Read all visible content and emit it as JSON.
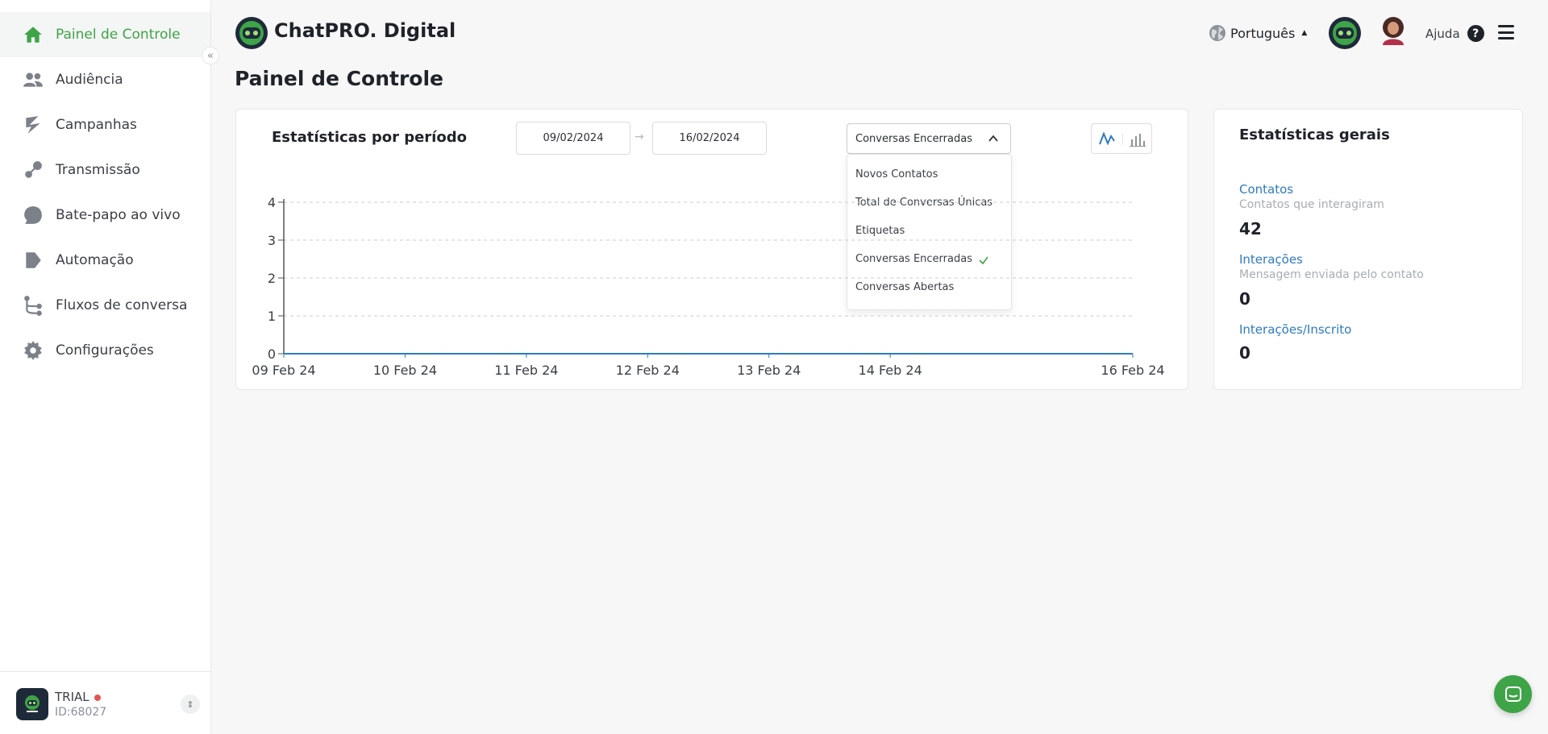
{
  "brand": {
    "name": "ChatPRO. Digital"
  },
  "sidebar": {
    "items": [
      {
        "label": "Painel de Controle",
        "icon": "home-icon",
        "active": true
      },
      {
        "label": "Audiência",
        "icon": "users-icon"
      },
      {
        "label": "Campanhas",
        "icon": "campaign-icon"
      },
      {
        "label": "Transmissão",
        "icon": "broadcast-icon"
      },
      {
        "label": "Bate-papo ao vivo",
        "icon": "chat-icon"
      },
      {
        "label": "Automação",
        "icon": "automation-icon"
      },
      {
        "label": "Fluxos de conversa",
        "icon": "flow-icon"
      },
      {
        "label": "Configurações",
        "icon": "gear-icon"
      }
    ],
    "footer": {
      "plan": "TRIAL",
      "account_id": "ID:68027"
    }
  },
  "header": {
    "language": "Português",
    "help_label": "Ajuda"
  },
  "page": {
    "title": "Painel de Controle"
  },
  "period_stats": {
    "title": "Estatísticas por período",
    "start_date": "09/02/2024",
    "end_date": "16/02/2024",
    "selected_metric": "Conversas Encerradas",
    "metric_options": [
      "Novos Contatos",
      "Total de Conversas Únicas",
      "Etiquetas",
      "Conversas Encerradas",
      "Conversas Abertas"
    ]
  },
  "general_stats": {
    "title": "Estatísticas gerais",
    "contacts": {
      "label": "Contatos",
      "sub": "Contatos que interagiram",
      "value": "42"
    },
    "interactions": {
      "label": "Interações",
      "sub": "Mensagem enviada pelo contato",
      "value": "0"
    },
    "interactions_per_sub": {
      "label": "Interações/Inscrito",
      "value": "0"
    }
  },
  "colors": {
    "accent": "#3ea447",
    "link": "#2e7bc0",
    "line": "#2e7bc0"
  },
  "chart_data": {
    "type": "line",
    "x": [
      "09 Feb 24",
      "10 Feb 24",
      "11 Feb 24",
      "12 Feb 24",
      "13 Feb 24",
      "14 Feb 24",
      "16 Feb 24"
    ],
    "series": [
      {
        "values": [
          0,
          0,
          0,
          0,
          0,
          0,
          0
        ]
      }
    ],
    "ylim": [
      0,
      4
    ],
    "yticks": [
      0,
      1,
      2,
      3,
      4
    ],
    "grid": true
  }
}
